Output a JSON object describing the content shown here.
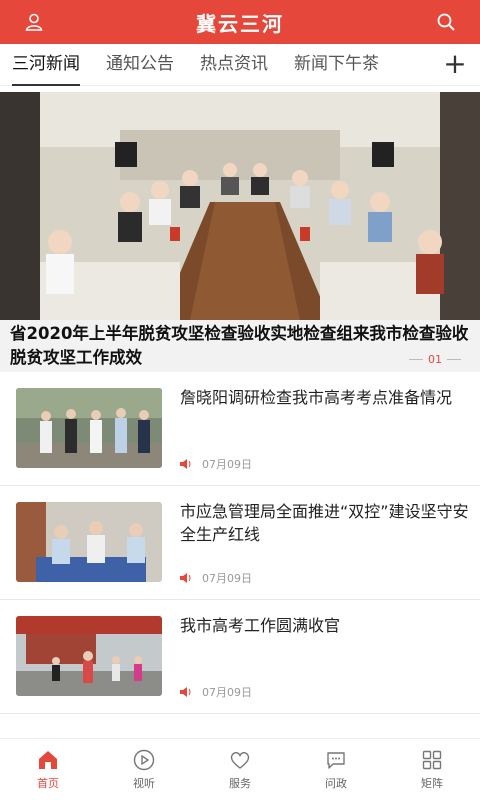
{
  "header": {
    "title": "冀云三河",
    "user_icon": "user-icon",
    "search_icon": "search-icon"
  },
  "tabs": [
    {
      "label": "三河新闻",
      "active": true
    },
    {
      "label": "通知公告"
    },
    {
      "label": "热点资讯"
    },
    {
      "label": "新闻下午茶"
    }
  ],
  "tab_add_label": "+",
  "hero": {
    "title": "省2020年上半年脱贫攻坚检查验收实地检查组来我市检查验收脱贫攻坚工作成效",
    "indicator": "01"
  },
  "news": [
    {
      "title": "詹晓阳调研检查我市高考考点准备情况",
      "date": "07月09日"
    },
    {
      "title": "市应急管理局全面推进“双控”建设坚守安全生产红线",
      "date": "07月09日"
    },
    {
      "title": "我市高考工作圆满收官",
      "date": "07月09日"
    }
  ],
  "bottom_nav": [
    {
      "label": "首页",
      "icon": "home-icon",
      "active": true
    },
    {
      "label": "视听",
      "icon": "play-icon"
    },
    {
      "label": "服务",
      "icon": "heart-icon"
    },
    {
      "label": "问政",
      "icon": "chat-icon"
    },
    {
      "label": "矩阵",
      "icon": "grid-icon"
    }
  ],
  "colors": {
    "accent": "#e5473b"
  }
}
